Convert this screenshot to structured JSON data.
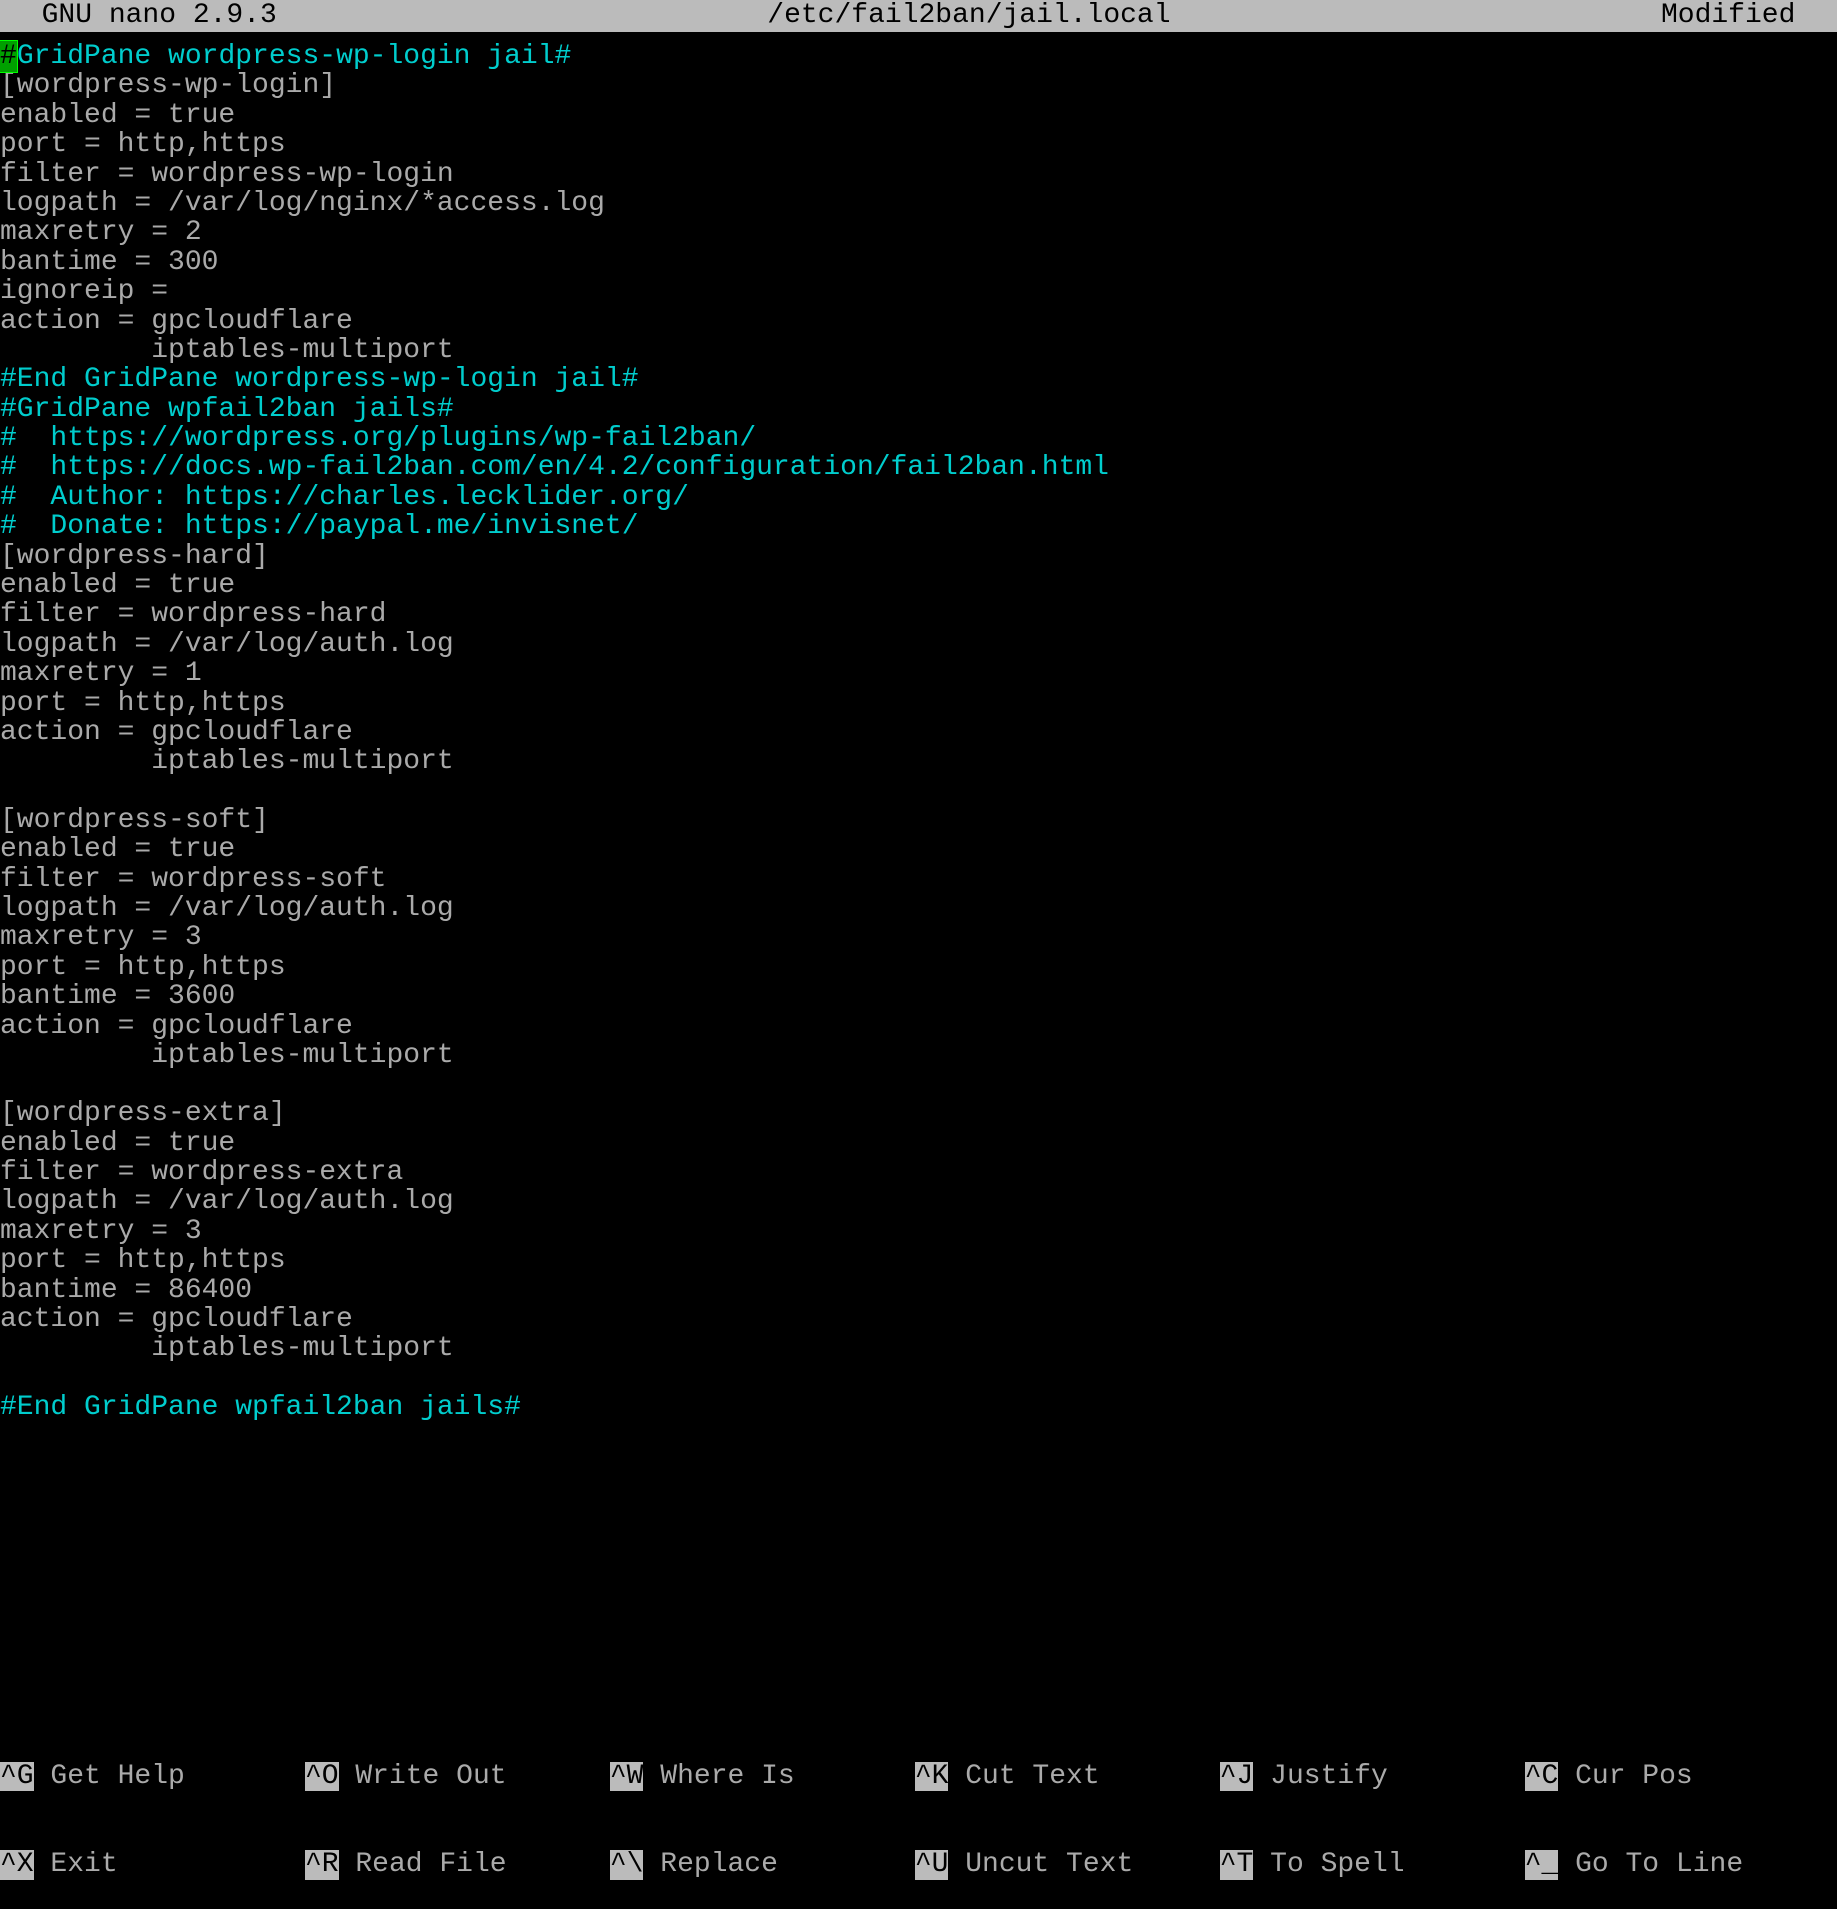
{
  "titlebar": {
    "left": "  GNU nano 2.9.3",
    "center": "/etc/fail2ban/jail.local",
    "right": "Modified  "
  },
  "lines": [
    {
      "type": "cursor-comment",
      "cursor": "#",
      "text": "GridPane wordpress-wp-login jail#"
    },
    {
      "type": "text",
      "text": "[wordpress-wp-login]"
    },
    {
      "type": "text",
      "text": "enabled = true"
    },
    {
      "type": "text",
      "text": "port = http,https"
    },
    {
      "type": "text",
      "text": "filter = wordpress-wp-login"
    },
    {
      "type": "text",
      "text": "logpath = /var/log/nginx/*access.log"
    },
    {
      "type": "text",
      "text": "maxretry = 2"
    },
    {
      "type": "text",
      "text": "bantime = 300"
    },
    {
      "type": "text",
      "text": "ignoreip ="
    },
    {
      "type": "text",
      "text": "action = gpcloudflare"
    },
    {
      "type": "text",
      "text": "         iptables-multiport"
    },
    {
      "type": "comment",
      "text": "#End GridPane wordpress-wp-login jail#"
    },
    {
      "type": "comment",
      "text": "#GridPane wpfail2ban jails#"
    },
    {
      "type": "comment",
      "text": "#  https://wordpress.org/plugins/wp-fail2ban/"
    },
    {
      "type": "comment",
      "text": "#  https://docs.wp-fail2ban.com/en/4.2/configuration/fail2ban.html"
    },
    {
      "type": "comment",
      "text": "#  Author: https://charles.lecklider.org/"
    },
    {
      "type": "comment",
      "text": "#  Donate: https://paypal.me/invisnet/"
    },
    {
      "type": "text",
      "text": "[wordpress-hard]"
    },
    {
      "type": "text",
      "text": "enabled = true"
    },
    {
      "type": "text",
      "text": "filter = wordpress-hard"
    },
    {
      "type": "text",
      "text": "logpath = /var/log/auth.log"
    },
    {
      "type": "text",
      "text": "maxretry = 1"
    },
    {
      "type": "text",
      "text": "port = http,https"
    },
    {
      "type": "text",
      "text": "action = gpcloudflare"
    },
    {
      "type": "text",
      "text": "         iptables-multiport"
    },
    {
      "type": "text",
      "text": ""
    },
    {
      "type": "text",
      "text": "[wordpress-soft]"
    },
    {
      "type": "text",
      "text": "enabled = true"
    },
    {
      "type": "text",
      "text": "filter = wordpress-soft"
    },
    {
      "type": "text",
      "text": "logpath = /var/log/auth.log"
    },
    {
      "type": "text",
      "text": "maxretry = 3"
    },
    {
      "type": "text",
      "text": "port = http,https"
    },
    {
      "type": "text",
      "text": "bantime = 3600"
    },
    {
      "type": "text",
      "text": "action = gpcloudflare"
    },
    {
      "type": "text",
      "text": "         iptables-multiport"
    },
    {
      "type": "text",
      "text": ""
    },
    {
      "type": "text",
      "text": "[wordpress-extra]"
    },
    {
      "type": "text",
      "text": "enabled = true"
    },
    {
      "type": "text",
      "text": "filter = wordpress-extra"
    },
    {
      "type": "text",
      "text": "logpath = /var/log/auth.log"
    },
    {
      "type": "text",
      "text": "maxretry = 3"
    },
    {
      "type": "text",
      "text": "port = http,https"
    },
    {
      "type": "text",
      "text": "bantime = 86400"
    },
    {
      "type": "text",
      "text": "action = gpcloudflare"
    },
    {
      "type": "text",
      "text": "         iptables-multiport"
    },
    {
      "type": "text",
      "text": ""
    },
    {
      "type": "comment",
      "text": "#End GridPane wpfail2ban jails#"
    }
  ],
  "footer": {
    "row1": [
      {
        "key": "^G",
        "label": " Get Help"
      },
      {
        "key": "^O",
        "label": " Write Out"
      },
      {
        "key": "^W",
        "label": " Where Is"
      },
      {
        "key": "^K",
        "label": " Cut Text"
      },
      {
        "key": "^J",
        "label": " Justify"
      },
      {
        "key": "^C",
        "label": " Cur Pos"
      }
    ],
    "row2": [
      {
        "key": "^X",
        "label": " Exit"
      },
      {
        "key": "^R",
        "label": " Read File"
      },
      {
        "key": "^\\",
        "label": " Replace"
      },
      {
        "key": "^U",
        "label": " Uncut Text"
      },
      {
        "key": "^T",
        "label": " To Spell"
      },
      {
        "key": "^_",
        "label": " Go To Line"
      }
    ]
  }
}
